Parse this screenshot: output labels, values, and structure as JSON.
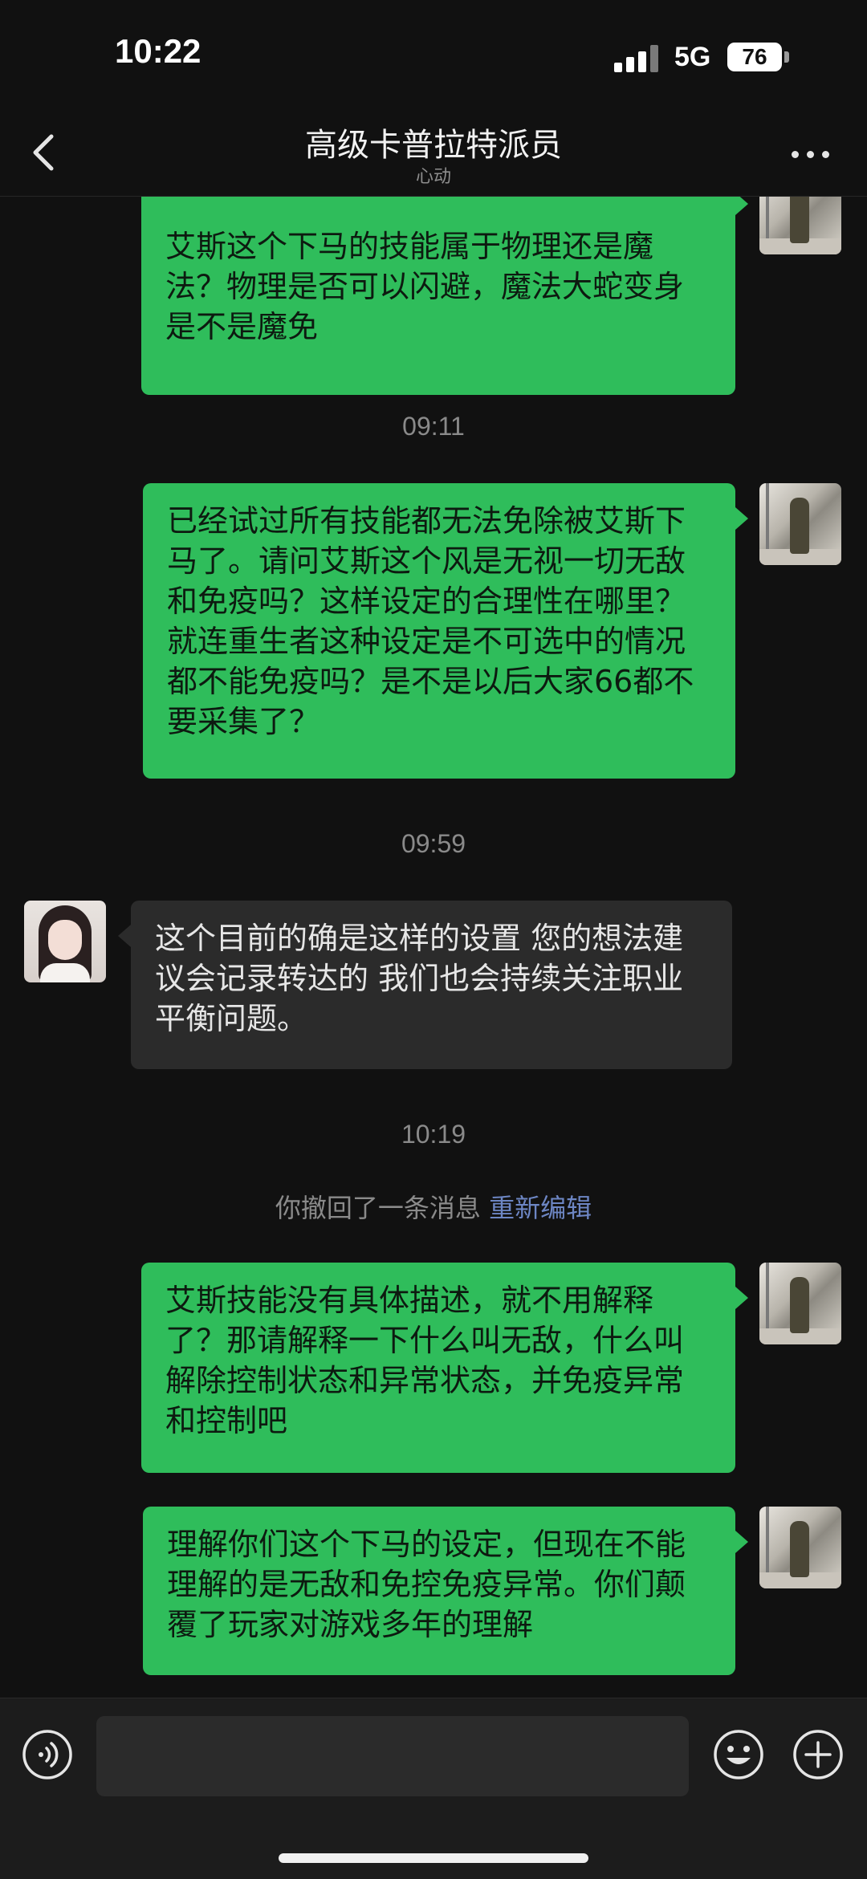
{
  "status_bar": {
    "time": "10:22",
    "network": "5G",
    "battery": "76"
  },
  "header": {
    "title": "高级卡普拉特派员",
    "subtitle": "心动"
  },
  "messages": {
    "m1": "艾斯这个下马的技能属于物理还是魔法？物理是否可以闪避，魔法大蛇变身是不是魔免",
    "t1": "09:11",
    "m2": "已经试过所有技能都无法免除被艾斯下马了。请问艾斯这个风是无视一切无敌和免疫吗？这样设定的合理性在哪里？就连重生者这种设定是不可选中的情况都不能免疫吗？是不是以后大家66都不要采集了？",
    "t2": "09:59",
    "m3": "这个目前的确是这样的设置 您的想法建议会记录转达的 我们也会持续关注职业平衡问题。",
    "t3": "10:19",
    "recall_note": "你撤回了一条消息",
    "reedit": "重新编辑",
    "m4": "艾斯技能没有具体描述，就不用解释了？那请解释一下什么叫无敌，什么叫解除控制状态和异常状态，并免疫异常和控制吧",
    "m5": "理解你们这个下马的设定，但现在不能理解的是无敌和免控免疫异常。你们颠覆了玩家对游戏多年的理解"
  },
  "input": {
    "value": "",
    "placeholder": ""
  },
  "colors": {
    "outgoing_bubble": "#2fbd5b",
    "incoming_bubble": "#2b2b2b",
    "background": "#111111",
    "link": "#6d86c4"
  },
  "icons": [
    "back-icon",
    "more-icon",
    "voice-icon",
    "emoji-icon",
    "plus-icon"
  ]
}
